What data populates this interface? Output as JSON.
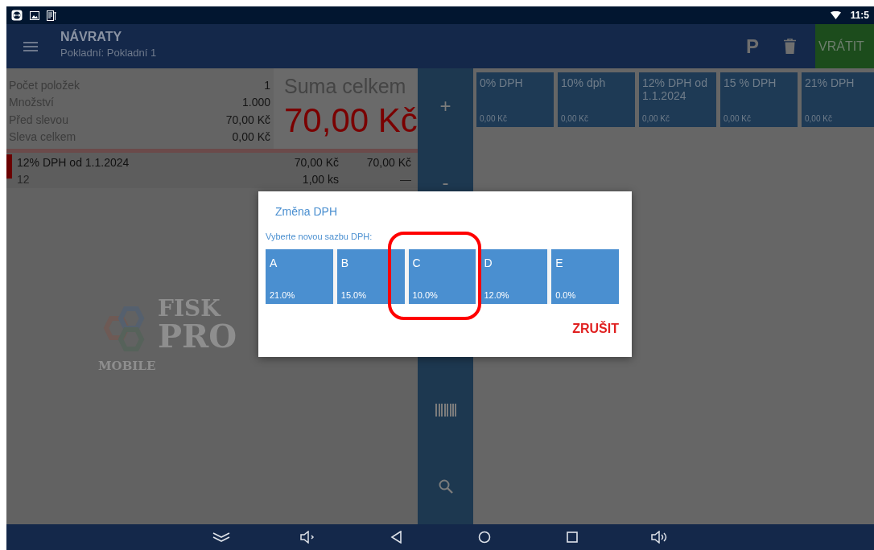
{
  "status_bar": {
    "time": "11:5"
  },
  "app_bar": {
    "title": "NÁVRATY",
    "subtitle": "Pokladní: Pokladní 1",
    "park_label": "P",
    "return_button": "VRÁTIT"
  },
  "summary": {
    "rows": [
      {
        "label": "Počet položek",
        "value": "1"
      },
      {
        "label": "Množství",
        "value": "1.000"
      },
      {
        "label": "Před slevou",
        "value": "70,00 Kč"
      },
      {
        "label": "Sleva celkem",
        "value": "0,00 Kč"
      }
    ],
    "total_label": "Suma celkem",
    "total": "70,00 Kč"
  },
  "items": [
    {
      "name": "12% DPH od 1.1.2024",
      "code": "12",
      "price": "70,00 Kč",
      "quantity": "1,00 ks",
      "total": "70,00 Kč",
      "discount": "—"
    }
  ],
  "side_buttons": [
    {
      "kind": "text",
      "label": "+"
    },
    {
      "kind": "text",
      "label": "-"
    },
    {
      "kind": "hidden"
    },
    {
      "kind": "hidden"
    },
    {
      "kind": "barcode"
    },
    {
      "kind": "search"
    }
  ],
  "vat_tiles": [
    {
      "name": "0% DPH",
      "amount": "0,00 Kč"
    },
    {
      "name": "10% dph",
      "amount": "0,00 Kč"
    },
    {
      "name": "12% DPH od 1.1.2024",
      "amount": "0,00 Kč"
    },
    {
      "name": "15 % DPH",
      "amount": "0,00 Kč"
    },
    {
      "name": "21% DPH",
      "amount": "0,00 Kč"
    }
  ],
  "logo": {
    "word_1": "FISK",
    "word_2": "PRO",
    "word_3": "MOBILE"
  },
  "dialog": {
    "title": "Změna DPH",
    "prompt": "Vyberte novou sazbu DPH:",
    "options": [
      {
        "letter": "A",
        "rate": "21.0%"
      },
      {
        "letter": "B",
        "rate": "15.0%"
      },
      {
        "letter": "C",
        "rate": "10.0%"
      },
      {
        "letter": "D",
        "rate": "12.0%"
      },
      {
        "letter": "E",
        "rate": "0.0%"
      }
    ],
    "cancel": "ZRUŠIT"
  }
}
